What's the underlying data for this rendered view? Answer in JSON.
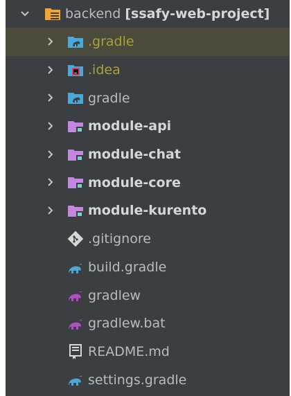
{
  "project": {
    "root": {
      "name": "backend",
      "tag": "[ssafy-web-project]"
    },
    "items": [
      {
        "label": ".gradle",
        "kind": "folder-gradle",
        "expandable": true,
        "selected": true,
        "style": "olive"
      },
      {
        "label": ".idea",
        "kind": "folder-idea",
        "expandable": true,
        "selected": false,
        "style": "olive"
      },
      {
        "label": "gradle",
        "kind": "folder-gradle",
        "expandable": true,
        "selected": false,
        "style": "normal"
      },
      {
        "label": "module-api",
        "kind": "module-folder",
        "expandable": true,
        "selected": false,
        "style": "bold"
      },
      {
        "label": "module-chat",
        "kind": "module-folder",
        "expandable": true,
        "selected": false,
        "style": "bold"
      },
      {
        "label": "module-core",
        "kind": "module-folder",
        "expandable": true,
        "selected": false,
        "style": "bold"
      },
      {
        "label": "module-kurento",
        "kind": "module-folder",
        "expandable": true,
        "selected": false,
        "style": "bold"
      },
      {
        "label": ".gitignore",
        "kind": "git-file",
        "expandable": false,
        "selected": false,
        "style": "normal"
      },
      {
        "label": "build.gradle",
        "kind": "gradle-file",
        "expandable": false,
        "selected": false,
        "style": "normal"
      },
      {
        "label": "gradlew",
        "kind": "gradlew-file",
        "expandable": false,
        "selected": false,
        "style": "normal"
      },
      {
        "label": "gradlew.bat",
        "kind": "gradlew-file",
        "expandable": false,
        "selected": false,
        "style": "normal"
      },
      {
        "label": "README.md",
        "kind": "markdown-file",
        "expandable": false,
        "selected": false,
        "style": "normal"
      },
      {
        "label": "settings.gradle",
        "kind": "gradle-file",
        "expandable": false,
        "selected": false,
        "style": "normal"
      }
    ]
  },
  "colors": {
    "panel": "#3c3f41",
    "selected_row": "#4b4b3c",
    "text": "#bbbbbb",
    "olive_text": "#a8a23a",
    "module_purple": "#c387e0",
    "gradle_blue": "#4aa9d8",
    "gradlew_purple": "#b04fc4",
    "idea_red": "#e53b5b"
  }
}
